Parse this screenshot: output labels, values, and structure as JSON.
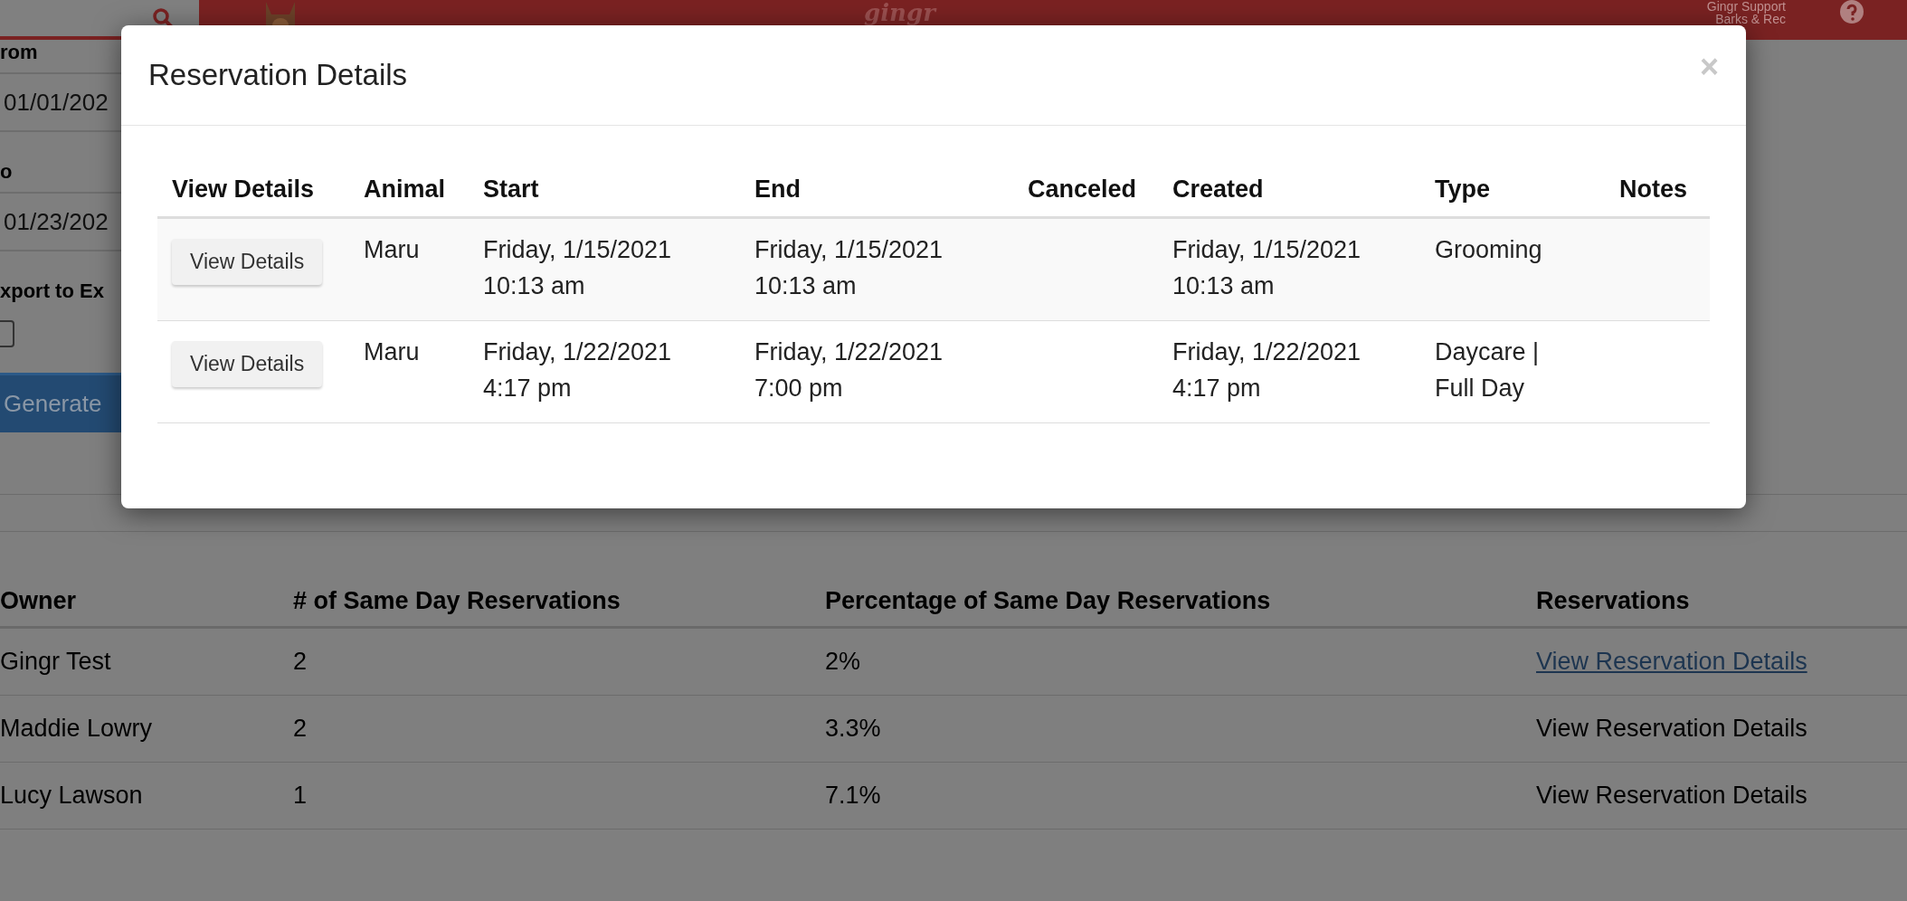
{
  "top_bar": {
    "logo": "gingr",
    "user_name": "Gingr Support",
    "location": "Barks & Rec"
  },
  "filters": {
    "from_label": "rom",
    "from_value": "01/01/202",
    "to_label": "o",
    "to_value": "01/23/202",
    "export_label": "xport to Ex",
    "export_checked": false,
    "generate_button": "Generate"
  },
  "report_table": {
    "columns": [
      "Owner",
      "# of Same Day Reservations",
      "Percentage of Same Day Reservations",
      "Reservations"
    ],
    "rows": [
      {
        "owner": "Gingr Test",
        "count": "2",
        "percentage": "2%",
        "reservations": "View Reservation Details",
        "link": true
      },
      {
        "owner": "Maddie Lowry",
        "count": "2",
        "percentage": "3.3%",
        "reservations": "View Reservation Details",
        "link": false
      },
      {
        "owner": "Lucy Lawson",
        "count": "1",
        "percentage": "7.1%",
        "reservations": "View Reservation Details",
        "link": false
      }
    ]
  },
  "modal": {
    "title": "Reservation Details",
    "close": "×",
    "columns": [
      "View Details",
      "Animal",
      "Start",
      "End",
      "Canceled",
      "Created",
      "Type",
      "Notes"
    ],
    "rows": [
      {
        "button": "View Details",
        "animal": "Maru",
        "start_date": "Friday, 1/15/2021",
        "start_time": "10:13 am",
        "end_date": "Friday, 1/15/2021",
        "end_time": "10:13 am",
        "created_date": "Friday, 1/15/2021",
        "created_time": "10:13 am",
        "type": "Grooming"
      },
      {
        "button": "View Details",
        "animal": "Maru",
        "start_date": "Friday, 1/22/2021",
        "start_time": "4:17 pm",
        "end_date": "Friday, 1/22/2021",
        "end_time": "7:00 pm",
        "created_date": "Friday, 1/22/2021",
        "created_time": "4:17 pm",
        "type": "Daycare | Full Day"
      }
    ]
  }
}
